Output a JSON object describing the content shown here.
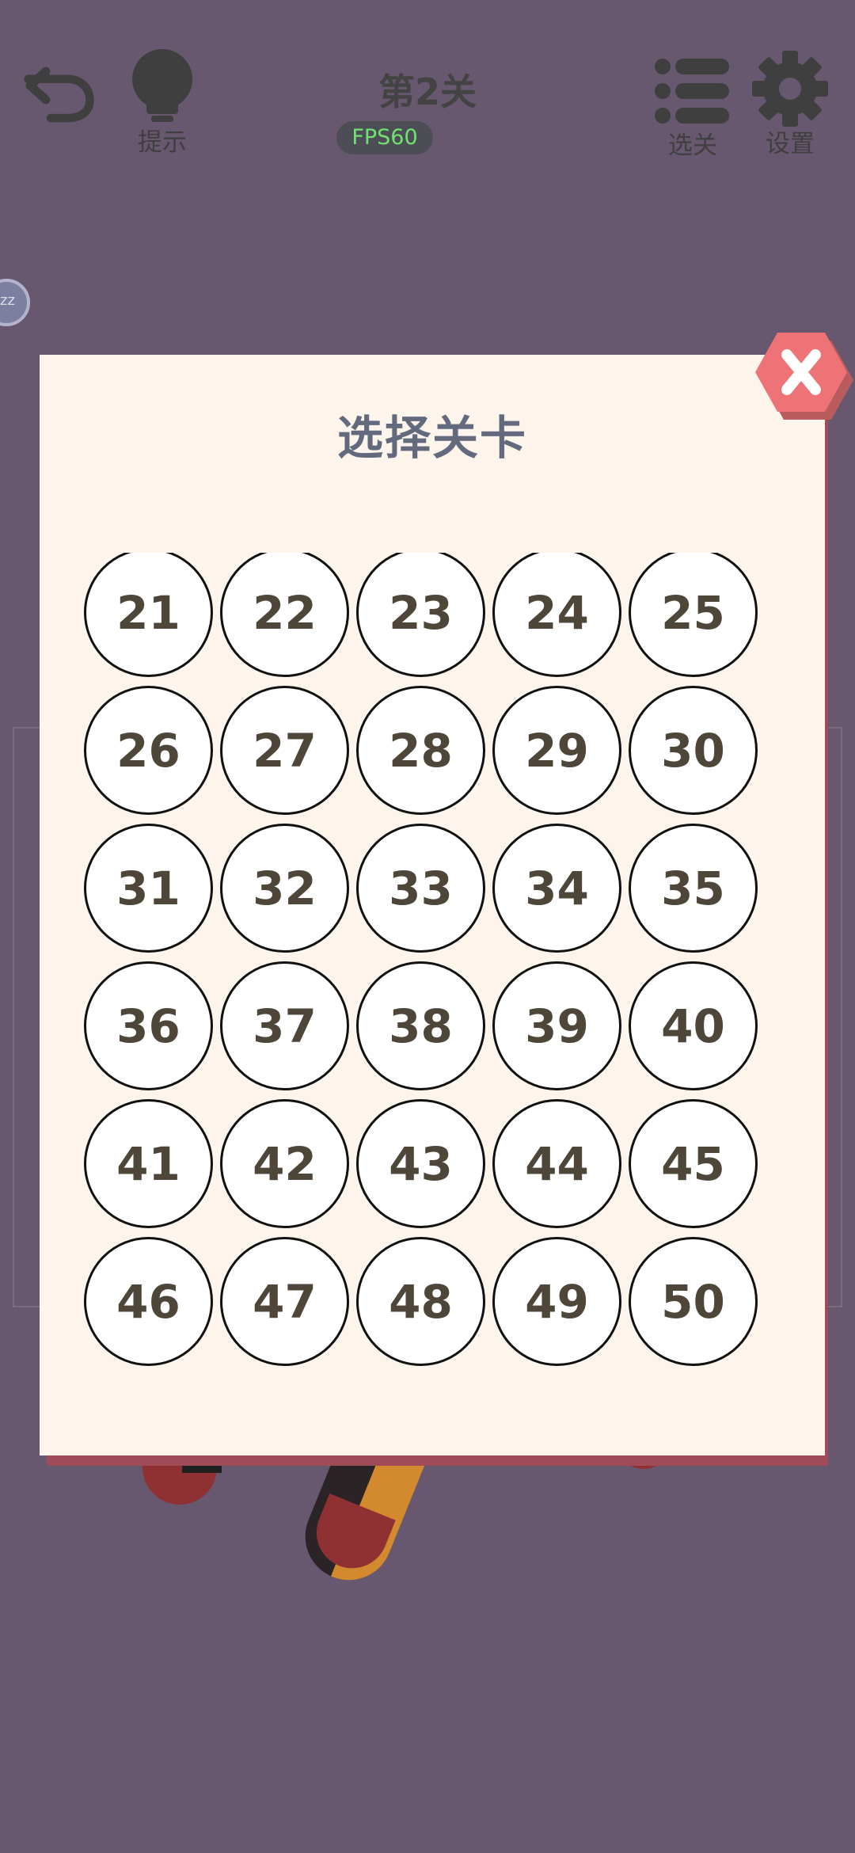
{
  "header": {
    "back_label": "",
    "hint_label": "提示",
    "level_title": "第2关",
    "fps": "FPS60",
    "select_label": "选关",
    "settings_label": "设置"
  },
  "side": {
    "avatar_text": "zz"
  },
  "modal": {
    "title": "选择关卡",
    "levels": [
      "21",
      "22",
      "23",
      "24",
      "25",
      "26",
      "27",
      "28",
      "29",
      "30",
      "31",
      "32",
      "33",
      "34",
      "35",
      "36",
      "37",
      "38",
      "39",
      "40",
      "41",
      "42",
      "43",
      "44",
      "45",
      "46",
      "47",
      "48",
      "49",
      "50"
    ]
  },
  "colors": {
    "background": "#67586f",
    "modal_bg": "#fdf4ec",
    "close_button": "#ee7377",
    "fps_text": "#6fe36f"
  }
}
